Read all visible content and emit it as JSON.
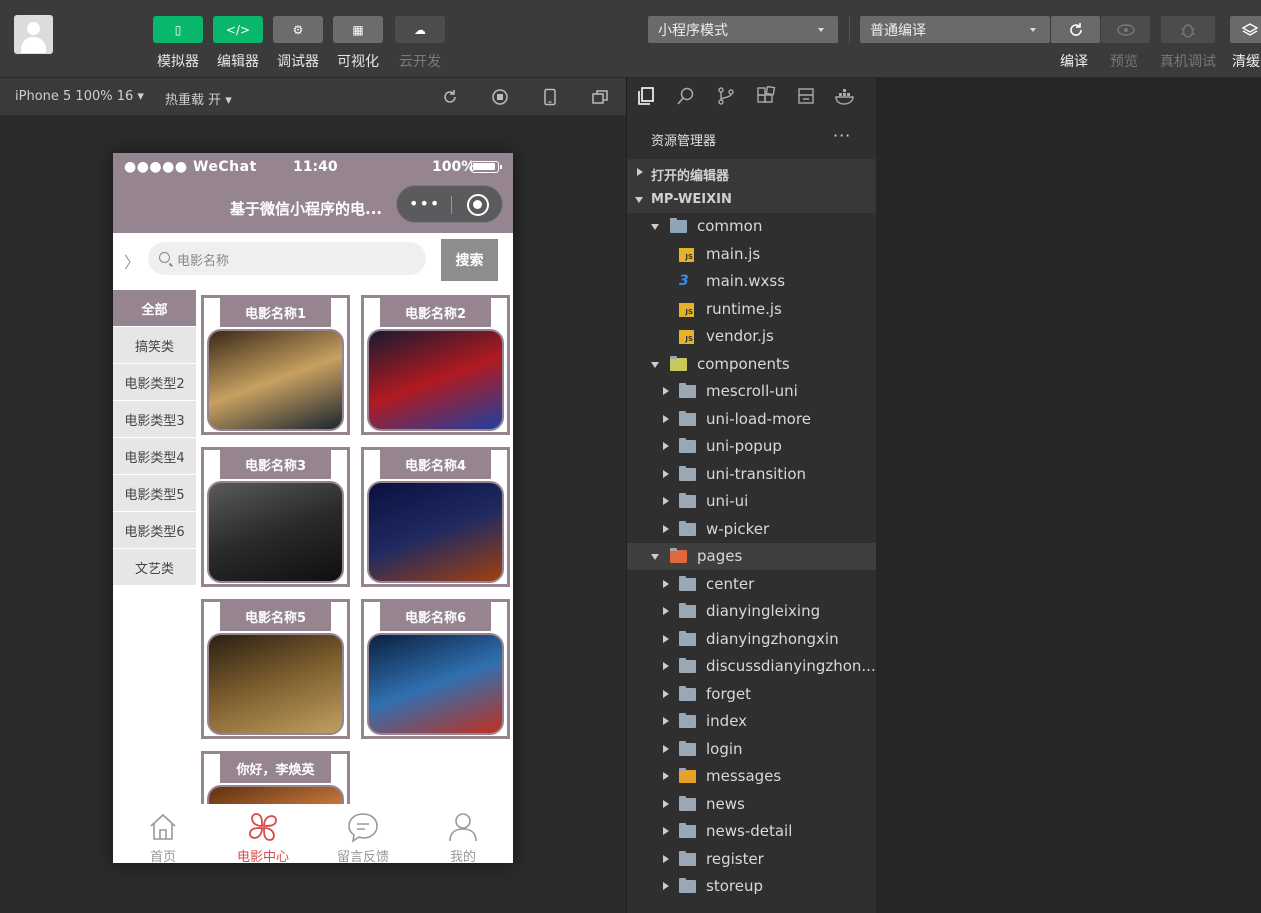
{
  "toolbar": {
    "buttons": [
      {
        "label": "模拟器",
        "glyph": "▯",
        "style": "green"
      },
      {
        "label": "编辑器",
        "glyph": "</>",
        "style": "green"
      },
      {
        "label": "调试器",
        "glyph": "⚙",
        "style": "gray"
      },
      {
        "label": "可视化",
        "glyph": "▦",
        "style": "gray"
      },
      {
        "label": "云开发",
        "glyph": "☁",
        "style": "dim"
      }
    ],
    "mode_select": "小程序模式",
    "compile_select": "普通编译",
    "right_labels": {
      "compile": "编译",
      "preview": "预览",
      "device_debug": "真机调试",
      "clear_cache": "清缓"
    }
  },
  "simbar": {
    "device": "iPhone 5 100% 16",
    "hot_reload": "热重载 开"
  },
  "phone": {
    "status": {
      "carrier": "●●●●● WeChat",
      "time": "11:40",
      "battery": "100%"
    },
    "page_title": "基于微信小程序的电...",
    "capsule_dots": "•••",
    "search": {
      "placeholder": "电影名称",
      "button": "搜索",
      "chevron": "〉"
    },
    "categories": [
      "全部",
      "搞笑类",
      "电影类型2",
      "电影类型3",
      "电影类型4",
      "电影类型5",
      "电影类型6",
      "文艺类"
    ],
    "active_category": 0,
    "movies": [
      {
        "title": "电影名称1",
        "colors": [
          "#3a2a1a",
          "#c8a060",
          "#1a2530"
        ]
      },
      {
        "title": "电影名称2",
        "colors": [
          "#1a1a30",
          "#b01a20",
          "#2040a0"
        ]
      },
      {
        "title": "电影名称3",
        "colors": [
          "#5a5a5a",
          "#2a2a2a",
          "#0f0f0f"
        ]
      },
      {
        "title": "电影名称4",
        "colors": [
          "#0a1040",
          "#202a60",
          "#a04010"
        ]
      },
      {
        "title": "电影名称5",
        "colors": [
          "#2a2010",
          "#806030",
          "#c0a060"
        ]
      },
      {
        "title": "电影名称6",
        "colors": [
          "#0a2040",
          "#3070b0",
          "#c03020"
        ]
      },
      {
        "title": "你好，李焕英",
        "colors": [
          "#603010",
          "#d08040",
          "#f0c070"
        ]
      }
    ],
    "tabs": [
      {
        "label": "首页",
        "icon": "home-icon"
      },
      {
        "label": "电影中心",
        "icon": "clover-icon"
      },
      {
        "label": "留言反馈",
        "icon": "chat-bubble-icon"
      },
      {
        "label": "我的",
        "icon": "user-icon"
      }
    ],
    "active_tab": 1
  },
  "explorer": {
    "title": "资源管理器",
    "more": "···",
    "sections": {
      "open_editors": "打开的编辑器",
      "project": "MP-WEIXIN"
    },
    "tree": [
      {
        "name": "common",
        "kind": "folder-open",
        "depth": 1,
        "arrow": "down"
      },
      {
        "name": "main.js",
        "kind": "js",
        "depth": 2
      },
      {
        "name": "main.wxss",
        "kind": "css",
        "depth": 2
      },
      {
        "name": "runtime.js",
        "kind": "js",
        "depth": 2
      },
      {
        "name": "vendor.js",
        "kind": "js",
        "depth": 2
      },
      {
        "name": "components",
        "kind": "folder-components",
        "depth": 1,
        "arrow": "down"
      },
      {
        "name": "mescroll-uni",
        "kind": "folder",
        "depth": 2,
        "arrow": "right"
      },
      {
        "name": "uni-load-more",
        "kind": "folder",
        "depth": 2,
        "arrow": "right"
      },
      {
        "name": "uni-popup",
        "kind": "folder",
        "depth": 2,
        "arrow": "right"
      },
      {
        "name": "uni-transition",
        "kind": "folder",
        "depth": 2,
        "arrow": "right"
      },
      {
        "name": "uni-ui",
        "kind": "folder",
        "depth": 2,
        "arrow": "right"
      },
      {
        "name": "w-picker",
        "kind": "folder",
        "depth": 2,
        "arrow": "right"
      },
      {
        "name": "pages",
        "kind": "folder-pages",
        "depth": 1,
        "arrow": "down",
        "highlight": true
      },
      {
        "name": "center",
        "kind": "folder",
        "depth": 2,
        "arrow": "right"
      },
      {
        "name": "dianyingleixing",
        "kind": "folder",
        "depth": 2,
        "arrow": "right"
      },
      {
        "name": "dianyingzhongxin",
        "kind": "folder",
        "depth": 2,
        "arrow": "right"
      },
      {
        "name": "discussdianyingzhon...",
        "kind": "folder",
        "depth": 2,
        "arrow": "right"
      },
      {
        "name": "forget",
        "kind": "folder",
        "depth": 2,
        "arrow": "right"
      },
      {
        "name": "index",
        "kind": "folder",
        "depth": 2,
        "arrow": "right"
      },
      {
        "name": "login",
        "kind": "folder",
        "depth": 2,
        "arrow": "right"
      },
      {
        "name": "messages",
        "kind": "folder-messages",
        "depth": 2,
        "arrow": "right"
      },
      {
        "name": "news",
        "kind": "folder",
        "depth": 2,
        "arrow": "right"
      },
      {
        "name": "news-detail",
        "kind": "folder",
        "depth": 2,
        "arrow": "right"
      },
      {
        "name": "register",
        "kind": "folder",
        "depth": 2,
        "arrow": "right"
      },
      {
        "name": "storeup",
        "kind": "folder",
        "depth": 2,
        "arrow": "right"
      }
    ]
  },
  "colors": {
    "theme": "#968590",
    "green": "#09b86c",
    "active_tab": "#d84b4b"
  }
}
